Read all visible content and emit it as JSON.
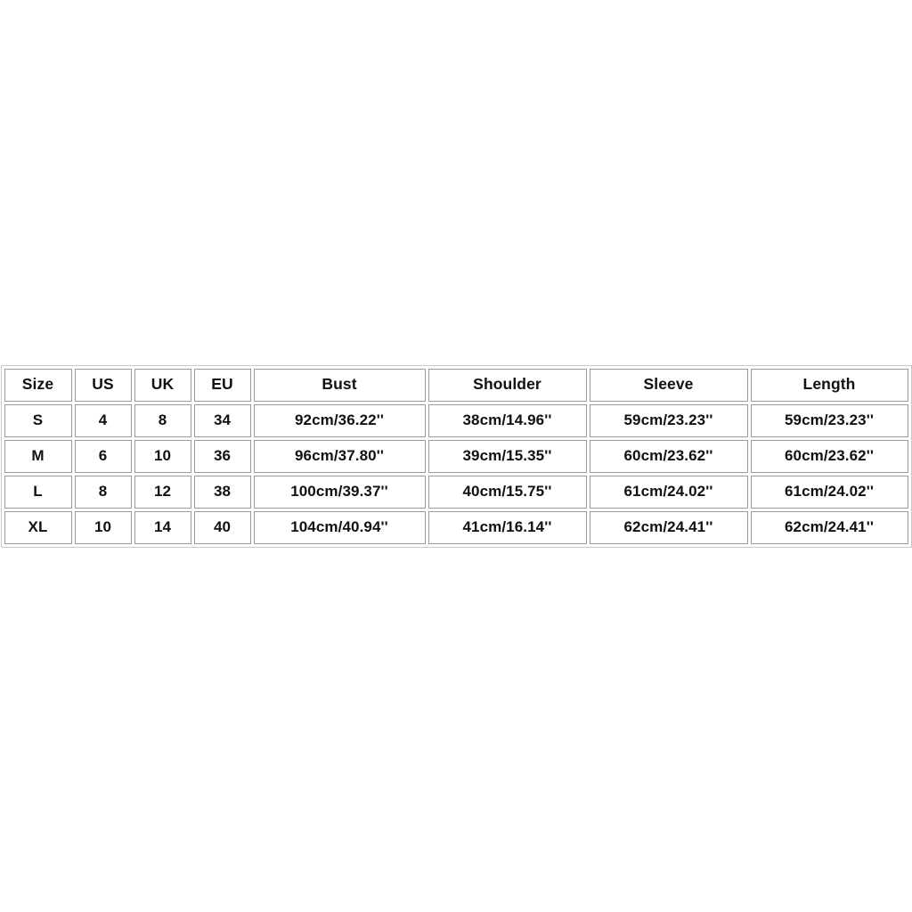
{
  "table": {
    "columns": [
      "Size",
      "US",
      "UK",
      "EU",
      "Bust",
      "Shoulder",
      "Sleeve",
      "Length"
    ],
    "rows": [
      {
        "size": "S",
        "us": "4",
        "uk": "8",
        "eu": "34",
        "bust": "92cm/36.22''",
        "shoulder": "38cm/14.96''",
        "sleeve": "59cm/23.23''",
        "length": "59cm/23.23''"
      },
      {
        "size": "M",
        "us": "6",
        "uk": "10",
        "eu": "36",
        "bust": "96cm/37.80''",
        "shoulder": "39cm/15.35''",
        "sleeve": "60cm/23.62''",
        "length": "60cm/23.62''"
      },
      {
        "size": "L",
        "us": "8",
        "uk": "12",
        "eu": "38",
        "bust": "100cm/39.37''",
        "shoulder": "40cm/15.75''",
        "sleeve": "61cm/24.02''",
        "length": "61cm/24.02''"
      },
      {
        "size": "XL",
        "us": "10",
        "uk": "14",
        "eu": "40",
        "bust": "104cm/40.94''",
        "shoulder": "41cm/16.14''",
        "sleeve": "62cm/24.41''",
        "length": "62cm/24.41''"
      }
    ]
  },
  "colors": {
    "page_background": "#ffffff",
    "cell_background": "#ffffff",
    "cell_border": "#9a9a9a",
    "outer_border": "#c9c9c9",
    "text": "#111111"
  }
}
